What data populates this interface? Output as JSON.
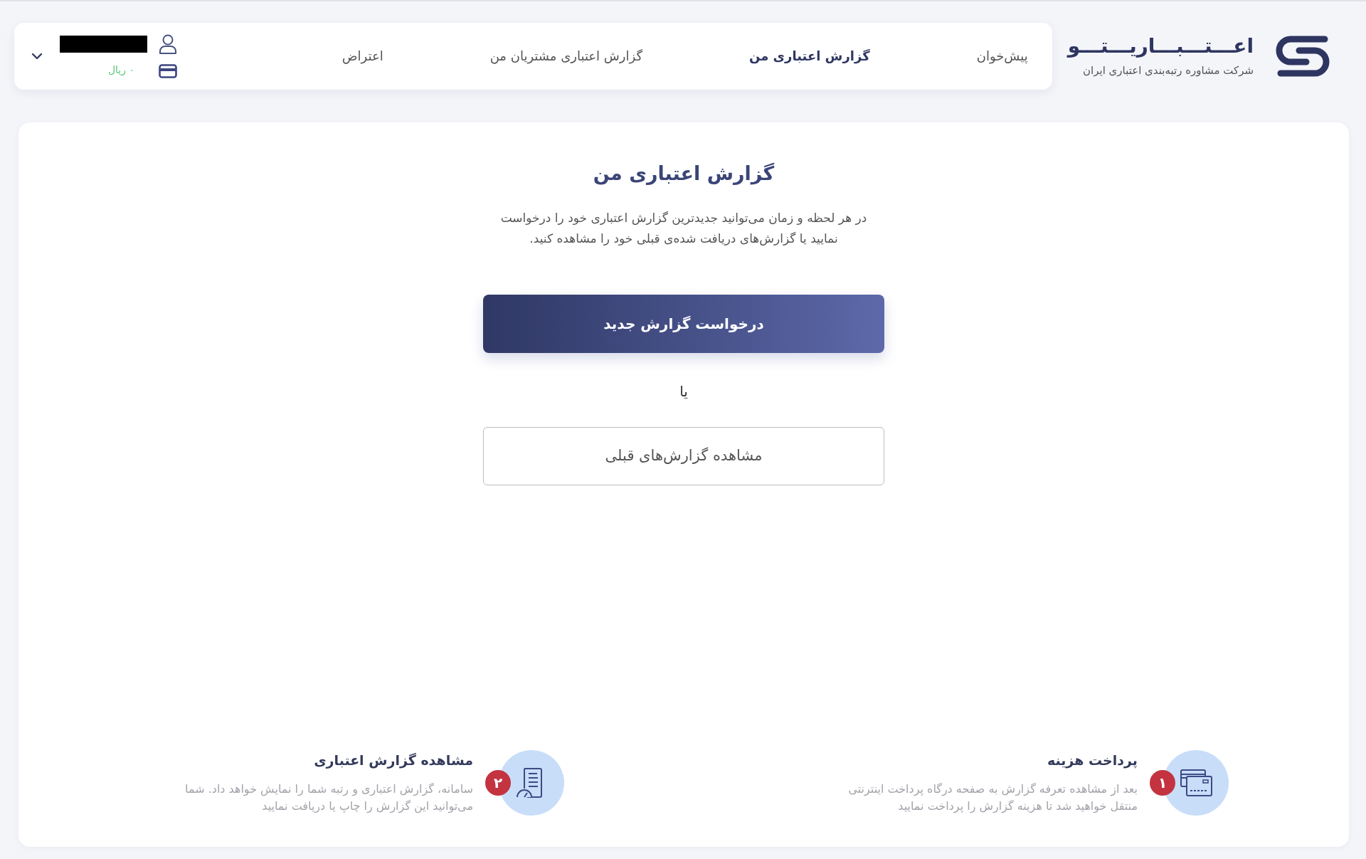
{
  "header": {
    "brand": {
      "title": "اعـــتـــبـــاریـــتـــو",
      "subtitle": "شرکت مشاوره رتبه‌بندی اعتباری ایران"
    },
    "nav": [
      {
        "label": "پیش‌خوان",
        "selected": false
      },
      {
        "label": "گزارش اعتباری من",
        "selected": true
      },
      {
        "label": "گزارش اعتباری مشتریان من",
        "selected": false
      },
      {
        "label": "اعتراض",
        "selected": false
      }
    ],
    "account": {
      "balance": "۰ ریال"
    }
  },
  "main": {
    "title": "گزارش اعتباری من",
    "description": "در هر لحظه و زمان می‌توانید جدیدترین گزارش اعتباری خود را درخواست نمایید یا گزارش‌های دریافت شده‌ی قبلی خود را مشاهده کنید.",
    "primary_button": "درخواست گزارش جدید",
    "separator": "یا",
    "secondary_button": "مشاهده گزارش‌های قبلی",
    "steps": [
      {
        "kind": "payment",
        "number": "۱",
        "title": "پرداخت هزینه",
        "description": "بعد از مشاهده تعرفه گزارش به صفحه درگاه پرداخت اینترنتی منتقل خواهید شد تا هزینه گزارش را پرداخت نمایید"
      },
      {
        "kind": "report",
        "number": "۲",
        "title": "مشاهده گزارش اعتباری",
        "description": "سامانه، گزارش اعتباری و رتبه شما را نمایش خواهد داد. شما می‌توانید این گزارش را چاپ یا دریافت نمایید"
      }
    ]
  }
}
